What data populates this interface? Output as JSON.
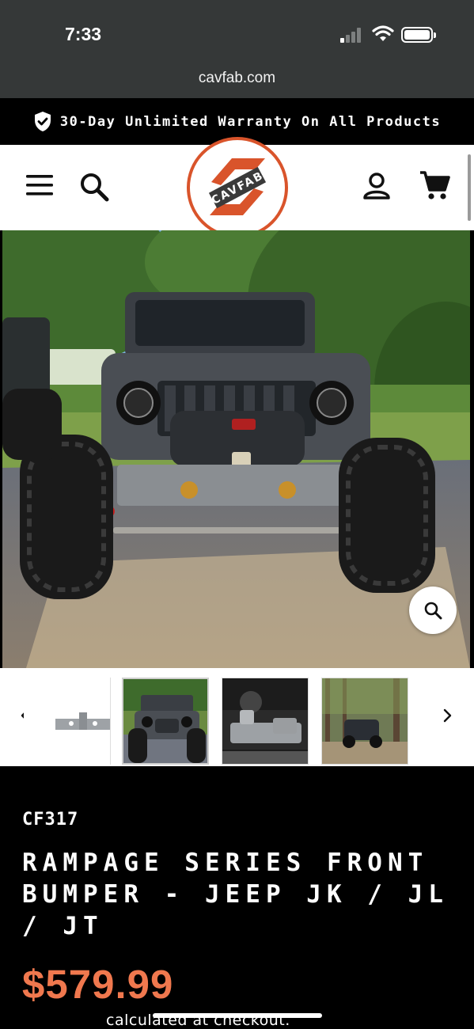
{
  "status_bar": {
    "time": "7:33",
    "url": "cavfab.com"
  },
  "announcement": {
    "text": "30-Day Unlimited Warranty On All Products",
    "icon": "shield-check-icon"
  },
  "header": {
    "logo_text": "CAVFAB",
    "icons": [
      "menu-icon",
      "search-icon",
      "account-icon",
      "cart-icon"
    ],
    "brand_color": "#d9542b"
  },
  "gallery": {
    "zoom_icon": "zoom-icon",
    "prev_icon": "chevron-left-icon",
    "next_icon": "chevron-right-icon",
    "thumbnail_count": 4,
    "selected_thumbnail": 2
  },
  "product": {
    "sku": "CF317",
    "title": "Rampage Series Front Bumper - Jeep JK / JL / JT",
    "price": "$579.99",
    "price_color": "#f0784e",
    "shipping_note": "calculated at checkout."
  }
}
